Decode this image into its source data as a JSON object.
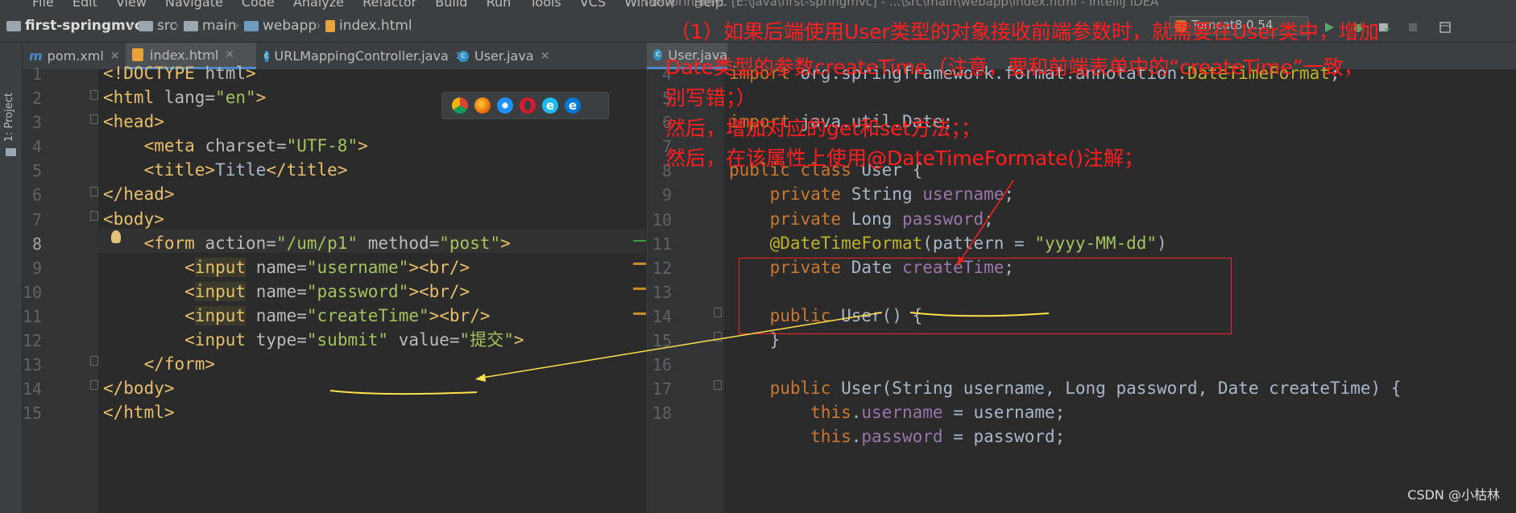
{
  "menu": {
    "items": [
      "File",
      "Edit",
      "View",
      "Navigate",
      "Code",
      "Analyze",
      "Refactor",
      "Build",
      "Run",
      "Tools",
      "VCS",
      "Window",
      "Help"
    ],
    "window_title": "first-springmvc [E:\\java\\first-springmvc] - ...\\src\\main\\webapp\\index.html - IntelliJ IDEA"
  },
  "breadcrumb": {
    "project": "first-springmvc",
    "items": [
      "src",
      "main",
      "webapp",
      "index.html"
    ]
  },
  "run_config": {
    "label": "Tomcat8.0.54"
  },
  "sidebar": {
    "project_label": "1: Project"
  },
  "tabs": [
    {
      "label": "pom.xml",
      "icon": "maven-icon"
    },
    {
      "label": "index.html",
      "icon": "html-file-icon",
      "active": true
    },
    {
      "label": "URLMappingController.java",
      "icon": "java-class-icon"
    },
    {
      "label": "User.java",
      "icon": "java-class-icon"
    }
  ],
  "right_tab": {
    "label": "User.java"
  },
  "left_editor": {
    "line_numbers": [
      "1",
      "2",
      "3",
      "4",
      "5",
      "6",
      "7",
      "8",
      "9",
      "10",
      "11",
      "12",
      "13",
      "14",
      "15"
    ],
    "current_line": 8
  },
  "right_editor": {
    "line_numbers": [
      "4",
      "5",
      "6",
      "7",
      "8",
      "9",
      "10",
      "11",
      "12",
      "13",
      "14",
      "15",
      "16",
      "17",
      "18"
    ]
  },
  "browsers": [
    "chrome-icon",
    "firefox-icon",
    "safari-icon",
    "opera-icon",
    "ie-icon",
    "edge-icon"
  ],
  "annotation": {
    "line1": "（1）如果后端使用User类型的对象接收前端参数时，就需要在User类中，增加",
    "line2": "Date类型的参数createTime（注意，要和前端表单中的“createTime”一致，",
    "line3": "别写错；）",
    "line4": "然后，增加对应的get和set方法；；",
    "line5": "然后，在该属性上使用@DateTimeFormate()注解；"
  },
  "watermark": "CSDN @小枯林",
  "colors": {
    "accent": "#4a88c7",
    "annotation": "#ff1f1f",
    "underline": "#ffe14d"
  }
}
